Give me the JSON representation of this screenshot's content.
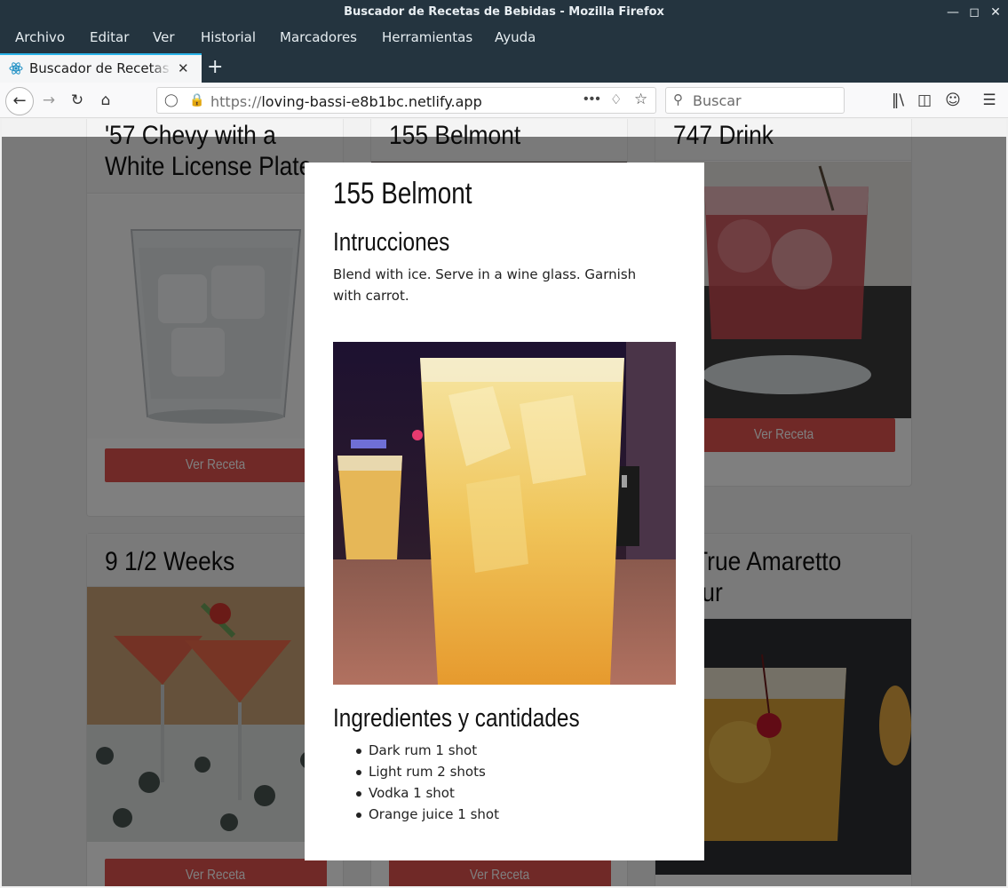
{
  "window": {
    "title": "Buscador de Recetas de Bebidas - Mozilla Firefox"
  },
  "menu": [
    "Archivo",
    "Editar",
    "Ver",
    "Historial",
    "Marcadores",
    "Herramientas",
    "Ayuda"
  ],
  "tab": {
    "label": "Buscador de Recetas de Bebidas"
  },
  "navbar": {
    "url_prefix": "https://",
    "url_host": "loving-bassi-e8b1bc.netlify.app",
    "search_placeholder": "Buscar"
  },
  "cards": [
    {
      "title_line1": "'57 Chevy with a",
      "title_line2": "White License Plate",
      "button": "Ver Receta"
    },
    {
      "title_line1": "155 Belmont",
      "button": "Ver Receta"
    },
    {
      "title_line1": "747 Drink",
      "button": "Ver Receta"
    },
    {
      "title_line1": "9 1/2 Weeks",
      "button": "Ver Receta"
    },
    {
      "title_line1": "A True Amaretto",
      "title_line2": "Sour",
      "button": "Ver Receta"
    },
    {
      "button": "Ver Receta"
    }
  ],
  "modal": {
    "title": "155 Belmont",
    "instructions_heading": "Intrucciones",
    "instructions": "Blend with ice. Serve in a wine glass. Garnish with carrot.",
    "ingredients_heading": "Ingredientes y cantidades",
    "ingredients": [
      "Dark rum 1 shot",
      "Light rum 2 shots",
      "Vodka 1 shot",
      "Orange juice 1 shot"
    ]
  },
  "colors": {
    "chrome": "#24343f",
    "tab_accent": "#2ab3e8",
    "button": "#e0534f"
  }
}
